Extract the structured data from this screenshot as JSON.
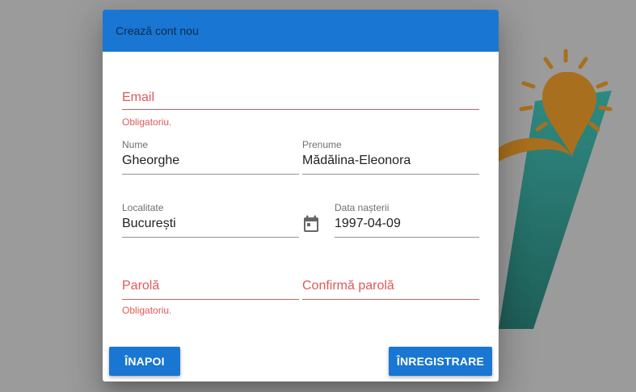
{
  "dialog": {
    "title": "Crează cont nou",
    "email": {
      "placeholder": "Email",
      "error": "Obligatoriu."
    },
    "nume": {
      "label": "Nume",
      "value": "Gheorghe"
    },
    "prenume": {
      "label": "Prenume",
      "value": "Mădălina-Eleonora"
    },
    "localitate": {
      "label": "Localitate",
      "value": "București"
    },
    "data_nasterii": {
      "label": "Data nașterii",
      "value": "1997-04-09"
    },
    "parola": {
      "placeholder": "Parolă",
      "error": "Obligatoriu."
    },
    "confirma_parola": {
      "placeholder": "Confirmă parolă"
    },
    "back_label": "ÎNAPOI",
    "register_label": "ÎNREGISTRARE"
  },
  "colors": {
    "primary": "#1976d2",
    "error": "#e05858",
    "logo_teal": "#2a7f78",
    "logo_gold": "#a8701e"
  },
  "icons": {
    "calendar": "calendar-icon",
    "logo": "logo-lightbulb"
  }
}
